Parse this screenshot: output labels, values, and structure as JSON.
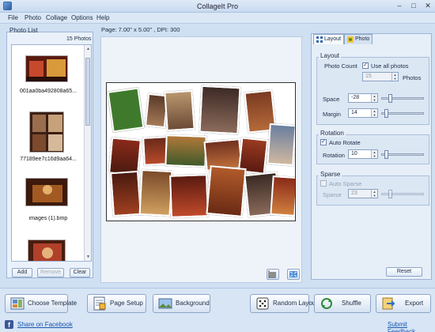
{
  "window": {
    "title": "CollageIt Pro",
    "min": "–",
    "max": "□",
    "close": "✕"
  },
  "menu": [
    "File",
    "Photo",
    "Collage",
    "Options",
    "Help"
  ],
  "photo_list": {
    "title": "Photo List",
    "count": "15 Photos",
    "items": [
      {
        "caption": "001aa0ba492808a65..."
      },
      {
        "caption": "77189ee7c16d9aa64..."
      },
      {
        "caption": "images (1).bmp"
      },
      {
        "caption": ""
      }
    ],
    "buttons": {
      "add": "Add",
      "remove": "Remove",
      "clear": "Clear"
    }
  },
  "page_info": "Page:  7.00\" x 5.00\" , DPI: 300",
  "tabs": {
    "layout": "Layout",
    "photo": "Photo"
  },
  "layout": {
    "group_title": "Layout",
    "photo_count_label": "Photo Count",
    "use_all_label": "Use all photos",
    "use_all_checked": true,
    "photo_count_value": "15",
    "photos_label": "Photos",
    "space_label": "Space",
    "space_value": "-28",
    "margin_label": "Margin",
    "margin_value": "14"
  },
  "rotation": {
    "group_title": "Rotation",
    "auto_rotate_label": "Auto Rotate",
    "auto_rotate_checked": true,
    "rotation_label": "Rotation",
    "rotation_value": "10"
  },
  "sparse": {
    "group_title": "Sparse",
    "auto_sparse_label": "Auto Sparse",
    "auto_sparse_checked": false,
    "sparse_label": "Sparse",
    "sparse_value": "23"
  },
  "reset": "Reset",
  "bottom": {
    "choose_template": "Choose Template",
    "page_setup": "Page Setup",
    "background": "Background",
    "random_layout": "Random Layout",
    "shuffle": "Shuffle",
    "export": "Export",
    "share_facebook": "Share on Facebook",
    "submit_feedback": "Submit Feedback"
  },
  "icons": {
    "app": "collage-app-icon",
    "layout_tab": "layout-grid-icon",
    "photo_tab": "photo-icon",
    "choose_template": "template-icon",
    "page_setup": "page-setup-icon",
    "background": "background-icon",
    "random_layout": "dice-icon",
    "shuffle": "shuffle-icon",
    "export": "export-icon",
    "facebook": "facebook-icon",
    "crop": "crop-icon",
    "fit": "fit-screen-icon"
  }
}
